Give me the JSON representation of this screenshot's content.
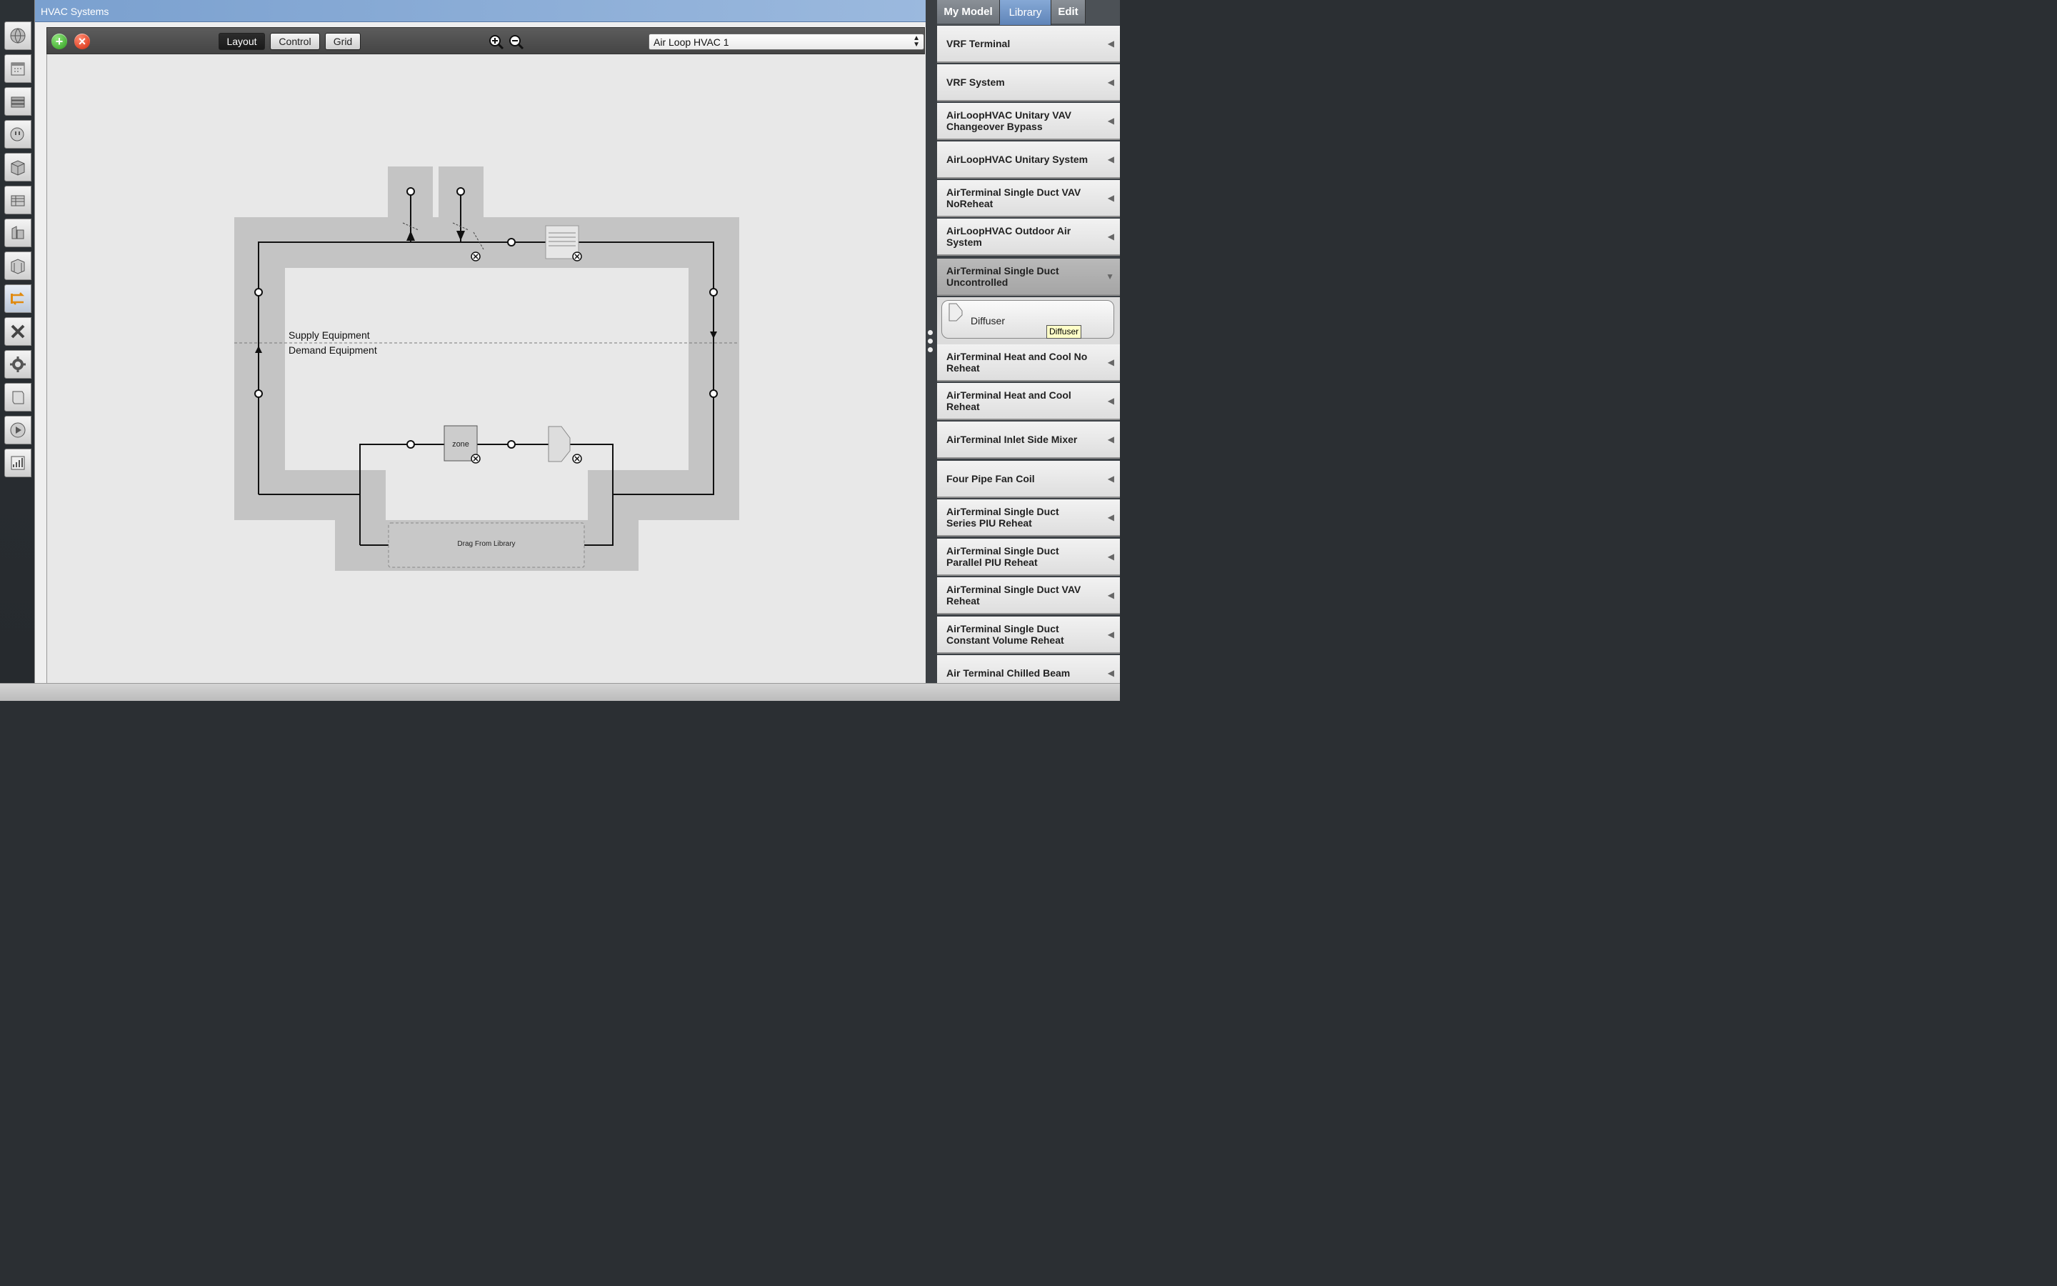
{
  "window": {
    "title": "HVAC Systems"
  },
  "left_tabs": [
    {
      "icon": "globe-icon"
    },
    {
      "icon": "calendar-icon"
    },
    {
      "icon": "construction-icon"
    },
    {
      "icon": "loads-icon"
    },
    {
      "icon": "space-types-icon"
    },
    {
      "icon": "geometry-icon"
    },
    {
      "icon": "facility-icon"
    },
    {
      "icon": "spaces-icon"
    },
    {
      "icon": "hvac-systems-icon",
      "active": true
    },
    {
      "icon": "variables-icon"
    },
    {
      "icon": "simulation-settings-icon"
    },
    {
      "icon": "scripts-icon"
    },
    {
      "icon": "run-icon"
    },
    {
      "icon": "results-icon"
    }
  ],
  "toolbar": {
    "add_icon": "add-icon",
    "delete_icon": "delete-icon",
    "layout_label": "Layout",
    "control_label": "Control",
    "grid_label": "Grid",
    "zoom_in_icon": "zoom-in-icon",
    "zoom_out_icon": "zoom-out-icon",
    "loop_selected": "Air Loop HVAC 1"
  },
  "diagram": {
    "supply_label": "Supply Equipment",
    "demand_label": "Demand Equipment",
    "zone_label": "zone",
    "drop_label": "Drag From Library"
  },
  "right_panel": {
    "tabs": [
      "My Model",
      "Library",
      "Edit"
    ],
    "active_tab": "Library",
    "items": [
      "VRF Terminal",
      "VRF System",
      "AirLoopHVAC Unitary VAV Changeover Bypass",
      "AirLoopHVAC Unitary System",
      "AirTerminal Single Duct VAV NoReheat",
      "AirLoopHVAC Outdoor Air System",
      "AirTerminal Single Duct Uncontrolled",
      "AirTerminal Heat and Cool No Reheat",
      "AirTerminal Heat and Cool Reheat",
      "AirTerminal Inlet Side Mixer",
      "Four Pipe Fan Coil",
      "AirTerminal Single Duct Series PIU Reheat",
      "AirTerminal Single Duct Parallel PIU Reheat",
      "AirTerminal Single Duct VAV Reheat",
      "AirTerminal Single Duct Constant Volume Reheat",
      "Air Terminal Chilled Beam"
    ],
    "expanded_item": "AirTerminal Single Duct Uncontrolled",
    "sub_item": "Diffuser",
    "tooltip": "Diffuser"
  }
}
